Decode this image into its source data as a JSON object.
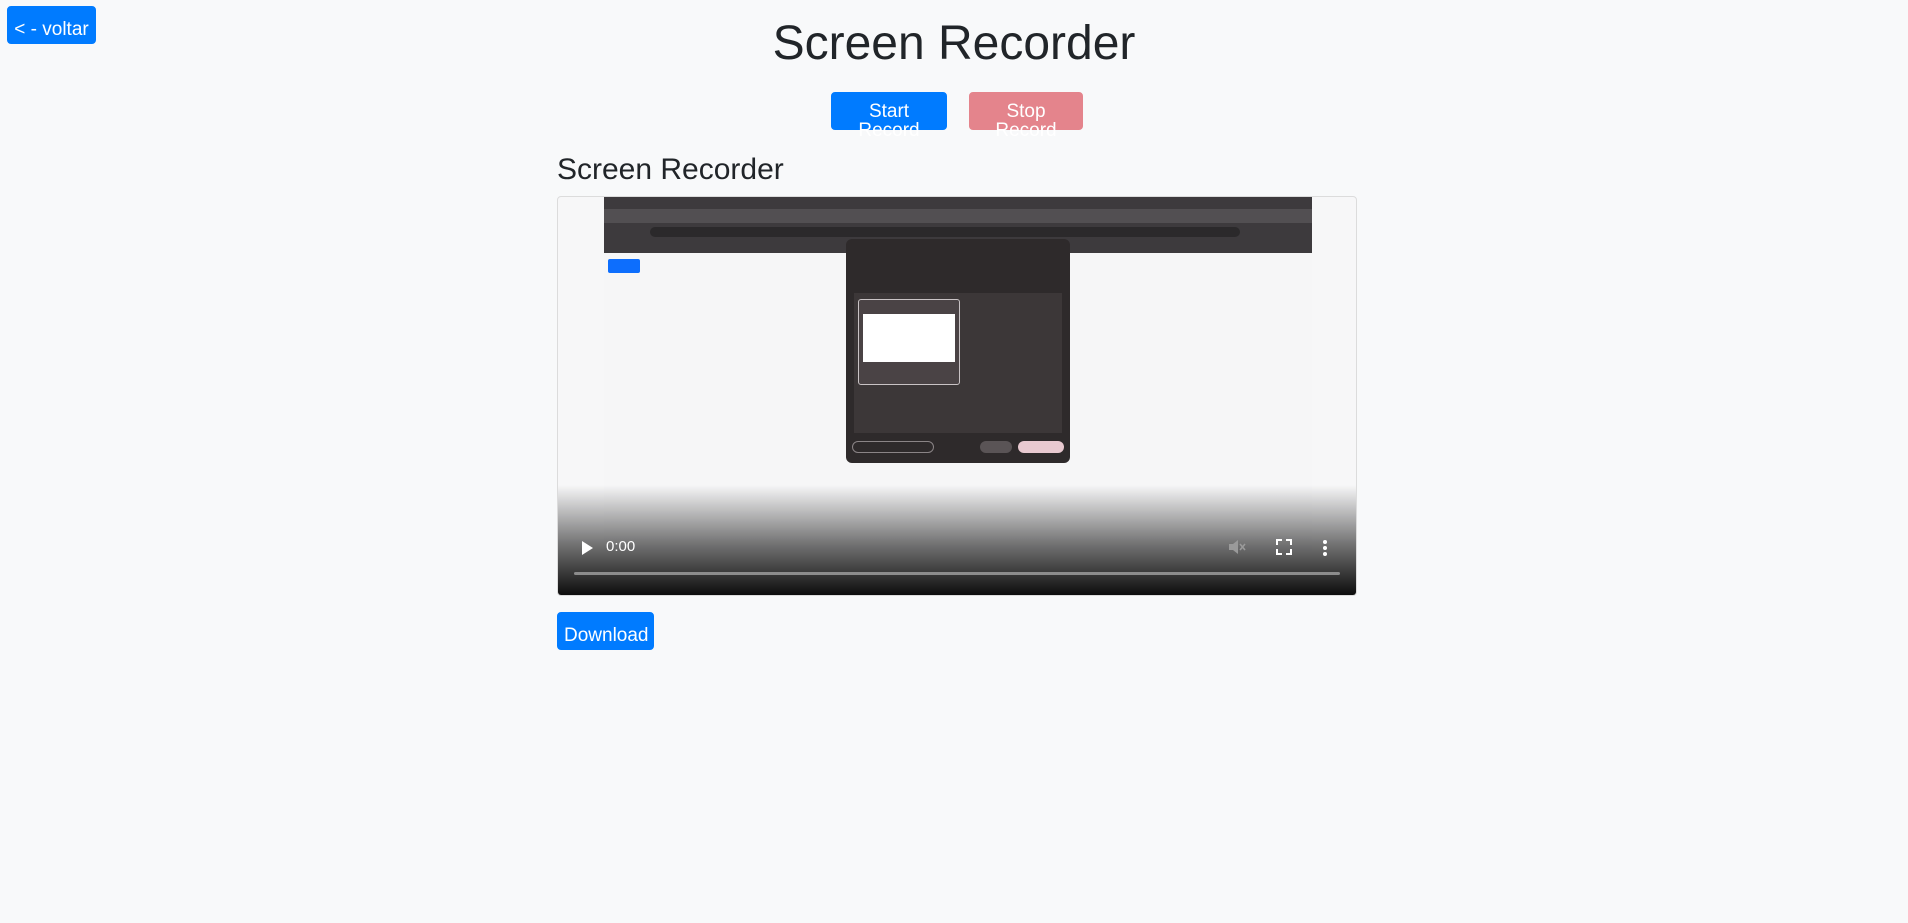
{
  "nav": {
    "back_label": "< - voltar"
  },
  "header": {
    "title": "Screen Recorder"
  },
  "controls": {
    "start_label": "Start Record",
    "stop_label": "Stop Record",
    "stop_disabled": true
  },
  "player": {
    "section_title": "Screen Recorder",
    "time": "0:00",
    "progress": 0,
    "icons": [
      "play-icon",
      "volume-muted-icon",
      "fullscreen-icon",
      "more-options-icon"
    ]
  },
  "actions": {
    "download_label": "Download"
  },
  "colors": {
    "primary": "#007bff",
    "danger_disabled": "#e4848c",
    "background": "#f8f9fa",
    "text": "#212529"
  }
}
